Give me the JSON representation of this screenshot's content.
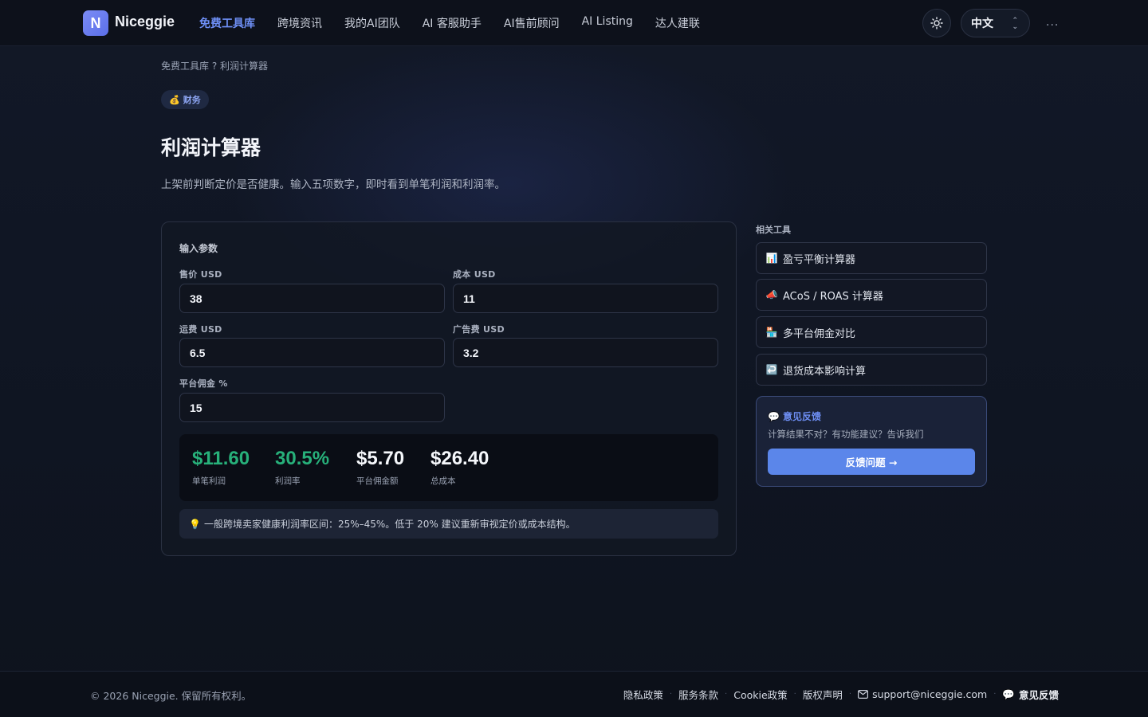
{
  "header": {
    "logo_letter": "N",
    "brand": "Niceggie",
    "nav": [
      {
        "label": "免费工具库",
        "active": true
      },
      {
        "label": "跨境资讯"
      },
      {
        "label": "我的AI团队"
      },
      {
        "label": "AI 客服助手"
      },
      {
        "label": "AI售前顾问"
      },
      {
        "label": "AI Listing"
      },
      {
        "label": "达人建联"
      }
    ],
    "theme_icon": "sun-icon",
    "language": "中文",
    "more": "..."
  },
  "breadcrumb": "免费工具库 ? 利润计算器",
  "badge": {
    "emoji": "💰",
    "label": "财务"
  },
  "title": "利润计算器",
  "subtitle": "上架前判断定价是否健康。输入五项数字，即时看到单笔利润和利润率。",
  "form": {
    "title": "输入参数",
    "fields": [
      {
        "label": "售价 USD",
        "value": "38"
      },
      {
        "label": "成本 USD",
        "value": "11"
      },
      {
        "label": "运费 USD",
        "value": "6.5"
      },
      {
        "label": "广告费 USD",
        "value": "3.2"
      },
      {
        "label": "平台佣金 %",
        "value": "15"
      }
    ]
  },
  "results": [
    {
      "value": "$11.60",
      "label": "单笔利润"
    },
    {
      "value": "30.5%",
      "label": "利润率"
    },
    {
      "value": "$5.70",
      "label": "平台佣金额"
    },
    {
      "value": "$26.40",
      "label": "总成本"
    }
  ],
  "tip": {
    "emoji": "💡",
    "text": "一般跨境卖家健康利润率区间：25%–45%。低于 20% 建议重新审视定价或成本结构。"
  },
  "related": {
    "title": "相关工具",
    "items": [
      {
        "emoji": "📊",
        "label": "盈亏平衡计算器"
      },
      {
        "emoji": "📣",
        "label": "ACoS / ROAS 计算器"
      },
      {
        "emoji": "🏪",
        "label": "多平台佣金对比"
      },
      {
        "emoji": "↩️",
        "label": "退货成本影响计算"
      }
    ]
  },
  "feedback": {
    "emoji": "💬",
    "title": "意见反馈",
    "desc": "计算结果不对？有功能建议？告诉我们",
    "button": "反馈问题 →"
  },
  "footer": {
    "copyright": "© 2026 Niceggie. 保留所有权利。",
    "links": [
      "隐私政策",
      "服务条款",
      "Cookie政策",
      "版权声明"
    ],
    "email": "support@niceggie.com",
    "feedback_emoji": "💬",
    "feedback": "意见反馈"
  },
  "colors": {
    "accent": "#6e8ff5",
    "profit": "#27b07a",
    "button": "#5b86ea",
    "background": "#0f1420"
  }
}
